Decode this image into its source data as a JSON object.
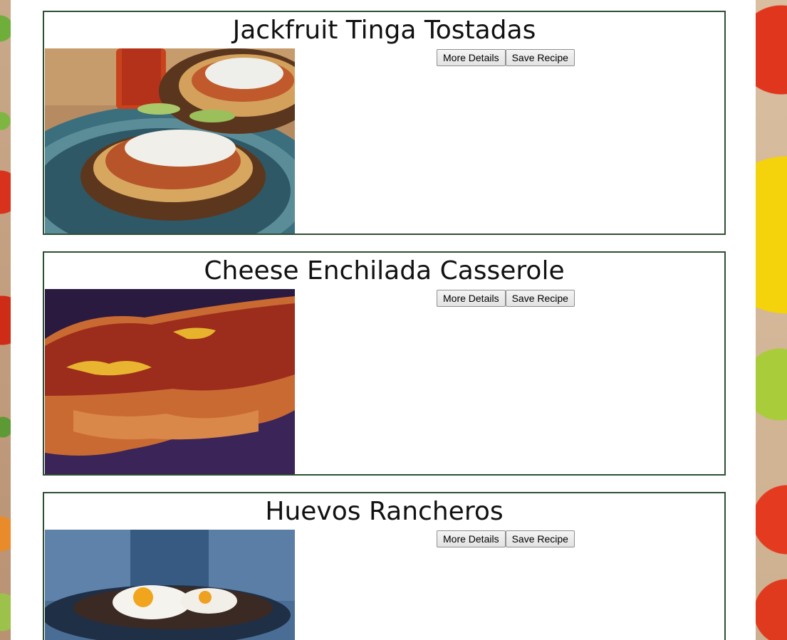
{
  "recipes": [
    {
      "title": "Jackfruit Tinga Tostadas",
      "photo": "jackfruit-tinga-tostadas-photo",
      "details_label": "More Details",
      "save_label": "Save Recipe"
    },
    {
      "title": "Cheese Enchilada Casserole",
      "photo": "cheese-enchilada-casserole-photo",
      "details_label": "More Details",
      "save_label": "Save Recipe"
    },
    {
      "title": "Huevos Rancheros",
      "photo": "huevos-rancheros-photo",
      "details_label": "More Details",
      "save_label": "Save Recipe"
    }
  ],
  "colors": {
    "card_border": "#2f4f33",
    "page_background": "#ffffff"
  }
}
